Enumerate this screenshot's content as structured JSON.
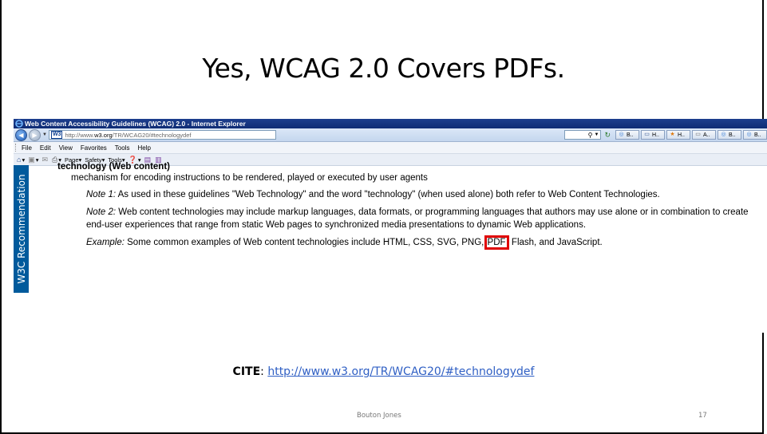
{
  "slide": {
    "title": "Yes, WCAG 2.0 Covers PDFs.",
    "cite_label": "CITE",
    "cite_separator": ": ",
    "cite_url": "http://www.w3.org/TR/WCAG20/#technologydef",
    "author": "Bouton Jones",
    "page_number": "17"
  },
  "browser": {
    "window_title": "Web Content Accessibility Guidelines (WCAG) 2.0 - Internet Explorer",
    "address_badge": "W3",
    "address_prefix": "http://www.",
    "address_domain": "w3.org",
    "address_path": "/TR/WCAG20/#technologydef",
    "tabs": [
      "B..",
      "H..",
      "H..",
      "A..",
      "B..",
      "B.."
    ],
    "menu": [
      "File",
      "Edit",
      "View",
      "Favorites",
      "Tools",
      "Help"
    ],
    "commands": [
      "Page",
      "Safety",
      "Tools"
    ]
  },
  "content": {
    "side_label": "W3C Recommendation",
    "term": "technology (Web content)",
    "definition": "mechanism for encoding instructions to be rendered, played or executed by user agents",
    "note1_label": "Note 1:",
    "note1_text": " As used in these guidelines \"Web Technology\" and the word \"technology\" (when used alone) both refer to Web Content Technologies.",
    "note2_label": "Note 2:",
    "note2_text": " Web content technologies may include markup languages, data formats, or programming languages that authors may use alone or in combination to create end-user experiences that range from static Web pages to synchronized media presentations to dynamic Web applications.",
    "example_label": "Example:",
    "example_before": " Some common examples of Web content technologies include HTML, CSS, SVG, PNG, ",
    "example_highlight": "PDF",
    "example_after": ", Flash, and JavaScript."
  },
  "colors": {
    "highlight": "#e00000",
    "w3c_blue": "#005a9c",
    "link": "#2f5fc4"
  }
}
